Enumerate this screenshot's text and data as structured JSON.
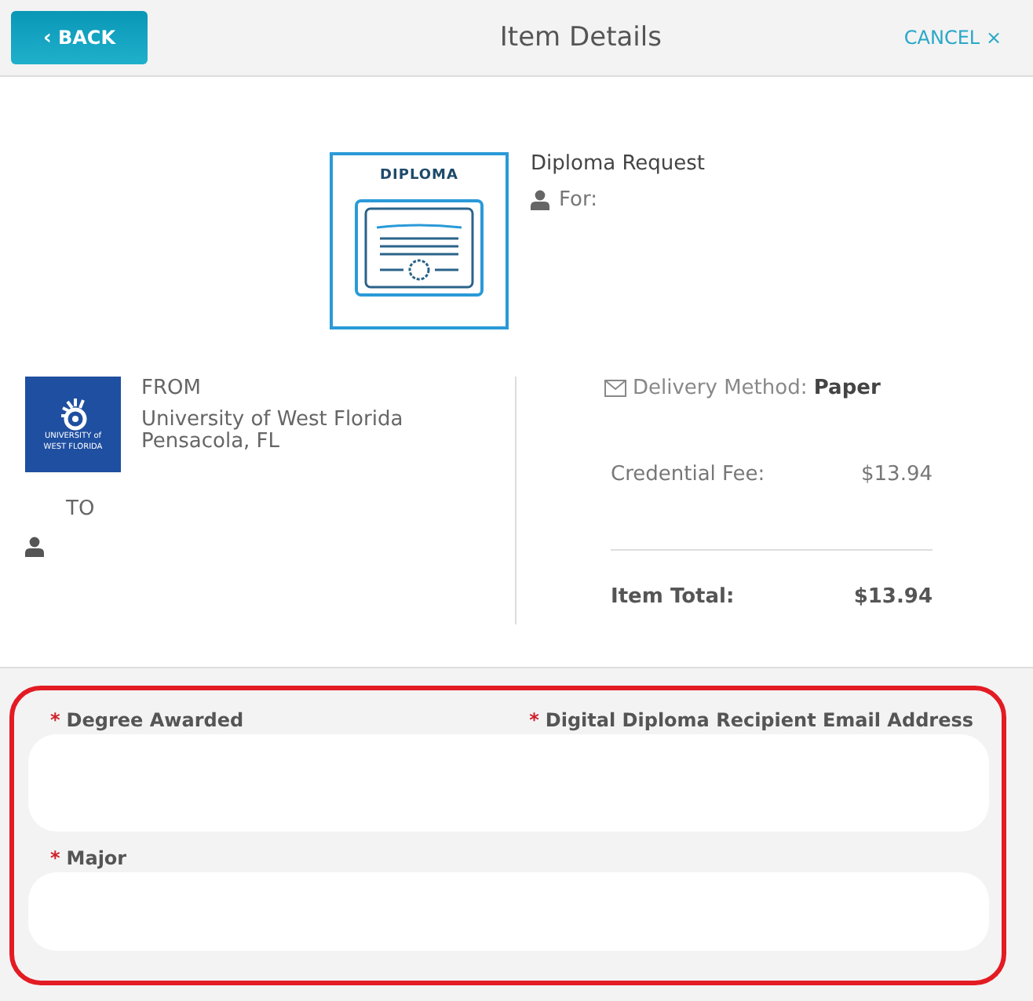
{
  "header": {
    "back_label": "BACK",
    "back_chevron": "‹",
    "title": "Item Details",
    "cancel_label": "CANCEL",
    "cancel_icon": "×"
  },
  "item": {
    "badge_label": "DIPLOMA",
    "title": "Diploma Request",
    "for_label": "For:"
  },
  "from": {
    "heading": "FROM",
    "logo_text": [
      "UNIVERSITY of",
      "WEST FLORIDA"
    ],
    "lines": [
      "University of West Florida",
      "Pensacola, FL"
    ]
  },
  "to": {
    "heading": "TO"
  },
  "delivery": {
    "label": "Delivery Method:",
    "value": "Paper"
  },
  "fees": [
    {
      "label": "Credential Fee:",
      "amount": "$13.94",
      "kind": "line"
    },
    {
      "label": "Item Total:",
      "amount": "$13.94",
      "kind": "total"
    }
  ],
  "form": {
    "highlighted": true,
    "fields": [
      {
        "labels": [
          {
            "text": "Degree Awarded",
            "required_mark": "*"
          },
          {
            "text": "Digital Diploma Recipient Email Address",
            "required_mark": "*"
          }
        ]
      },
      {
        "labels": [
          {
            "text": "Major",
            "required_mark": "*"
          }
        ]
      }
    ]
  }
}
